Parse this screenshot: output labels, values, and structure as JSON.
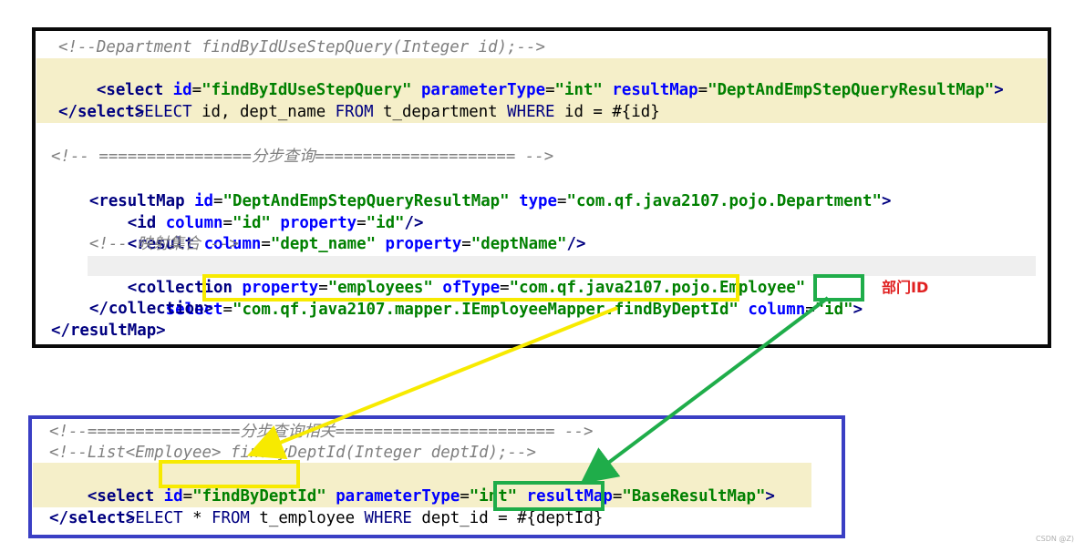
{
  "top": {
    "lines": [
      "<!--Department findByIdUseStepQuery(Integer id);-->",
      "<select id=\"findByIdUseStepQuery\" parameterType=\"int\" resultMap=\"DeptAndEmpStepQueryResultMap\">",
      "    SELECT id, dept_name FROM t_department WHERE id = #{id}",
      "</select>",
      "<!-- ================分步查询===================== -->",
      "<resultMap id=\"DeptAndEmpStepQueryResultMap\" type=\"com.qf.java2107.pojo.Department\">",
      "    <id column=\"id\" property=\"id\"/>",
      "    <result column=\"dept_name\" property=\"deptName\"/>",
      "    <!-- 映射集合 -->",
      "    <collection property=\"employees\" ofType=\"com.qf.java2107.pojo.Employee\"",
      "        select=\"com.qf.java2107.mapper.IEmployeeMapper.findByDeptId\" column=\"id\">",
      "    </collection>",
      "</resultMap>"
    ]
  },
  "bottom": {
    "lines": [
      "<!--================分步查询相关======================= -->",
      "<!--List<Employee> findByDeptId(Integer deptId);-->",
      "<select id=\"findByDeptId\" parameterType=\"int\" resultMap=\"BaseResultMap\">",
      "    SELECT * FROM t_employee WHERE dept_id = #{deptId}",
      "</select>"
    ]
  },
  "annotation": {
    "label": "部门ID"
  },
  "watermark": "CSDN @Z)",
  "colors": {
    "yellow": "#f7ea00",
    "green": "#1fad4a",
    "black_box": "#0a0a0a",
    "blue_box": "#3a3fc4",
    "label_red": "#e02020"
  }
}
